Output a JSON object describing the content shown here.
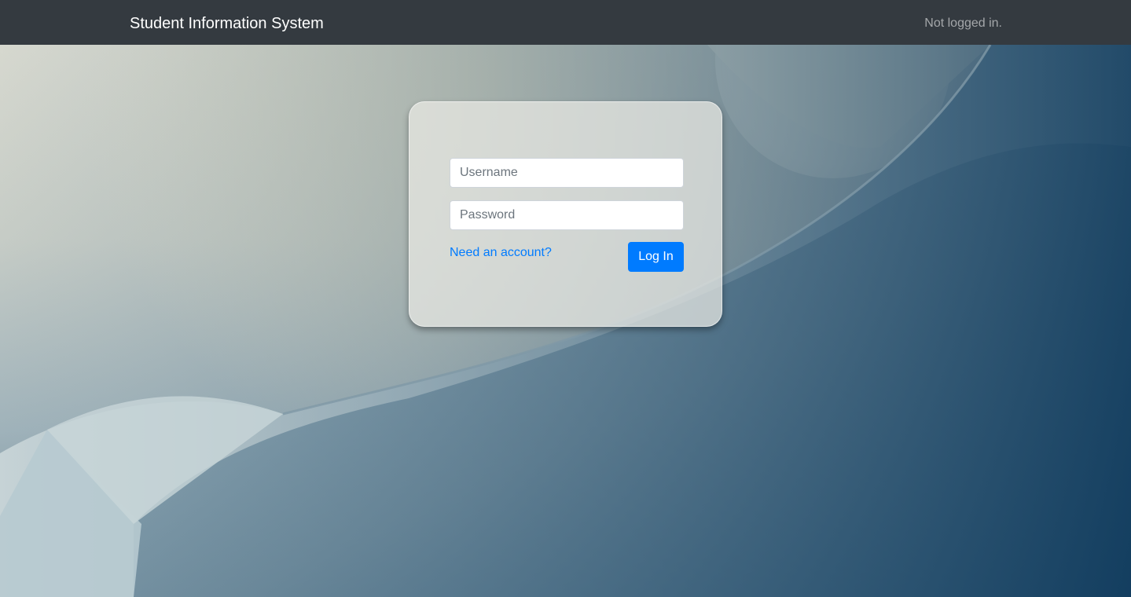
{
  "navbar": {
    "brand": "Student Information System",
    "status": "Not logged in."
  },
  "login_form": {
    "username_placeholder": "Username",
    "username_value": "",
    "password_placeholder": "Password",
    "password_value": "",
    "signup_link": "Need an account?",
    "submit_label": "Log In"
  },
  "colors": {
    "navbar_bg": "#343a40",
    "accent": "#007bff",
    "link": "#007bff"
  }
}
